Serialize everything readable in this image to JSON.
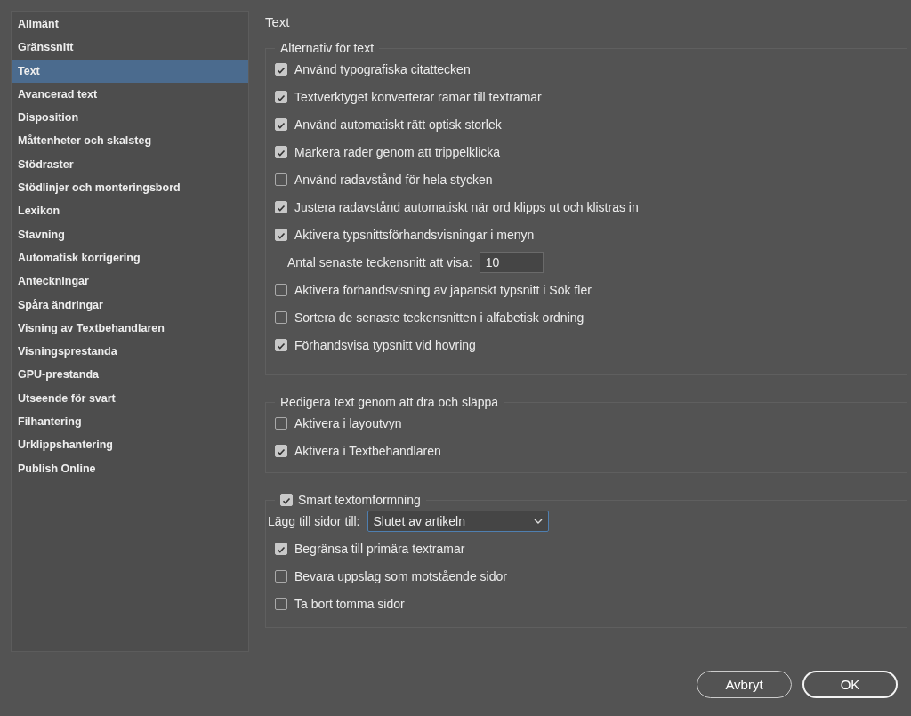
{
  "sidebar": {
    "items": [
      {
        "label": "Allmänt",
        "selected": false
      },
      {
        "label": "Gränssnitt",
        "selected": false
      },
      {
        "label": "Text",
        "selected": true
      },
      {
        "label": "Avancerad text",
        "selected": false
      },
      {
        "label": "Disposition",
        "selected": false
      },
      {
        "label": "Måttenheter och skalsteg",
        "selected": false
      },
      {
        "label": "Stödraster",
        "selected": false
      },
      {
        "label": "Stödlinjer och monteringsbord",
        "selected": false
      },
      {
        "label": "Lexikon",
        "selected": false
      },
      {
        "label": "Stavning",
        "selected": false
      },
      {
        "label": "Automatisk korrigering",
        "selected": false
      },
      {
        "label": "Anteckningar",
        "selected": false
      },
      {
        "label": "Spåra ändringar",
        "selected": false
      },
      {
        "label": "Visning av Textbehandlaren",
        "selected": false
      },
      {
        "label": "Visningsprestanda",
        "selected": false
      },
      {
        "label": "GPU-prestanda",
        "selected": false
      },
      {
        "label": "Utseende för svart",
        "selected": false
      },
      {
        "label": "Filhantering",
        "selected": false
      },
      {
        "label": "Urklippshantering",
        "selected": false
      },
      {
        "label": "Publish Online",
        "selected": false
      }
    ]
  },
  "page_title": "Text",
  "groups": [
    {
      "title": "Alternativ för text",
      "items": [
        {
          "kind": "checkbox",
          "label": "Använd typografiska citattecken",
          "checked": true
        },
        {
          "kind": "checkbox",
          "label": "Textverktyget konverterar ramar till textramar",
          "checked": true
        },
        {
          "kind": "checkbox",
          "label": "Använd automatiskt rätt optisk storlek",
          "checked": true
        },
        {
          "kind": "checkbox",
          "label": "Markera rader genom att trippelklicka",
          "checked": true
        },
        {
          "kind": "checkbox",
          "label": "Använd radavstånd för hela stycken",
          "checked": false
        },
        {
          "kind": "checkbox",
          "label": "Justera radavstånd automatiskt när ord klipps ut och klistras in",
          "checked": true
        },
        {
          "kind": "checkbox",
          "label": "Aktivera typsnittsförhandsvisningar i menyn",
          "checked": true
        },
        {
          "kind": "number",
          "label": "Antal senaste teckensnitt att visa:",
          "value": "10"
        },
        {
          "kind": "checkbox",
          "label": "Aktivera förhandsvisning av japanskt typsnitt i Sök fler",
          "checked": false
        },
        {
          "kind": "checkbox",
          "label": "Sortera de senaste teckensnitten i alfabetisk ordning",
          "checked": false
        },
        {
          "kind": "checkbox",
          "label": "Förhandsvisa typsnitt vid hovring",
          "checked": true
        }
      ]
    },
    {
      "title": "Redigera text genom att dra och släppa",
      "items": [
        {
          "kind": "checkbox",
          "label": "Aktivera i layoutvyn",
          "checked": false
        },
        {
          "kind": "checkbox",
          "label": "Aktivera i Textbehandlaren",
          "checked": true
        }
      ]
    },
    {
      "title": "Smart textomformning",
      "checked": true,
      "items": [
        {
          "kind": "select",
          "label": "Lägg till sidor till:",
          "value": "Slutet av artikeln"
        },
        {
          "kind": "checkbox",
          "label": "Begränsa till primära textramar",
          "checked": true
        },
        {
          "kind": "checkbox",
          "label": "Bevara uppslag som motstående sidor",
          "checked": false
        },
        {
          "kind": "checkbox",
          "label": "Ta bort tomma sidor",
          "checked": false
        }
      ]
    }
  ],
  "buttons": [
    {
      "label": "Avbryt",
      "kind": "secondary"
    },
    {
      "label": "OK",
      "kind": "primary"
    }
  ]
}
